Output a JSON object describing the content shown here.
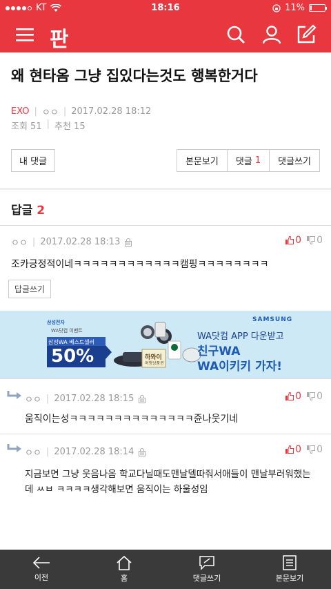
{
  "status": {
    "carrier": "KT",
    "time": "18:16",
    "battery": "11%",
    "battery_level": 0.11
  },
  "nav": {
    "logo": "판",
    "icons": [
      "menu-icon",
      "search-icon",
      "user-icon",
      "write-icon"
    ]
  },
  "post": {
    "title": "왜 현타옴 그냥 집있다는것도 행복한거다",
    "board": "EXO",
    "author": "ㅇㅇ",
    "datetime": "2017.02.28 18:12",
    "views": "조회 51",
    "recommend": "추천 15"
  },
  "actions": {
    "my_comments": "내 댓글",
    "view_post": "본문보기",
    "comments_label": "댓글",
    "comments_count": "1",
    "write_comment": "댓글쓰기"
  },
  "replies": {
    "label": "답글",
    "count": "2"
  },
  "comments": [
    {
      "author": "ㅇㅇ",
      "datetime": "2017.02.28 18:13",
      "up": "0",
      "down": "0",
      "text": "조카긍정적이네ㅋㅋㅋㅋㅋㅋㅋㅋㅋㅋㅋㅋ캠핑ㅋㅋㅋㅋㅋㅋㅋㅋ",
      "reply_btn": "답글쓰기"
    },
    {
      "author": "ㅇㅇ",
      "datetime": "2017.02.28 18:15",
      "up": "0",
      "down": "0",
      "text": "움직이는성ㅋㅋㅋㅋㅋㅋㅋㅋㅋㅋㅋㅋㅋㅋ쥰나웃기네"
    },
    {
      "author": "ㅇㅇ",
      "datetime": "2017.02.28 18:14",
      "up": "0",
      "down": "0",
      "text_line1": "지금보면 그냥 웃음나옴 학교다닐때도맨날델따줘서애들이 맨날부러워했는",
      "text_line2": "데 ㅆㅂ ㅋㅋㅋㅋ생각해보면 움직이는 하울성임"
    }
  ],
  "ad": {
    "brand_top": "삼성전자",
    "brand_sub": "WA닷컴 이벤트",
    "badge_small": "삼성WA 베스트셀러",
    "badge_big": "50%",
    "samsung": "SAMSUNG",
    "headline": "WA닷컴 APP 다운받고",
    "cta1": "친구WA",
    "cta2": "WA이키키 가자!",
    "sign": "하와이",
    "sign_sub": "여행상품권",
    "colors": {
      "bg": "#cde9f6",
      "navy": "#1b3f8f",
      "blue": "#1e5bb5"
    }
  },
  "bottom": {
    "prev": "이전",
    "home": "홈",
    "write": "댓글쓰기",
    "view": "본문보기"
  },
  "colors": {
    "accent": "#e8373f",
    "bottom_bar": "#3a3a3a"
  }
}
